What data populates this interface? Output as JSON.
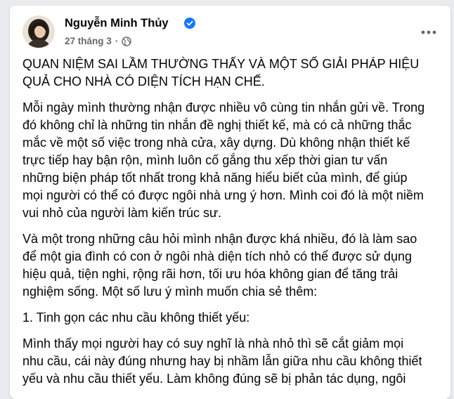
{
  "post": {
    "author": "Nguyễn Minh Thủy",
    "date": "27 tháng 3",
    "separator": "·",
    "verified_icon": "verified-badge-icon",
    "privacy_icon": "globe-icon",
    "more_icon": "more-options-icon",
    "colors": {
      "verified": "#1877f2",
      "meta": "#65676b",
      "text": "#050505"
    },
    "paragraphs": [
      "QUAN NIỆM SAI LẦM THƯỜNG THẤY VÀ MỘT SỐ GIẢI PHÁP HIỆU\nQUẢ CHO NHÀ CÓ DIỆN TÍCH HẠN CHẾ.",
      "Mỗi ngày mình thường nhận được nhiều vô cùng tin nhắn gửi về. Trong\nđó không chỉ là những tin nhắn đề nghị thiết kế, mà có cả những thắc\nmắc về một số việc trong nhà cửa, xây dựng. Dù không nhận thiết kế\ntrực tiếp hay bận rộn, mình luôn cố gắng thu xếp thời gian tư vấn\nnhững biện pháp tốt nhất trong khả năng hiểu biết của mình, để giúp\nmọi người có thể có được ngôi nhà ưng ý hơn. Mình coi đó là một niềm\nvui nhỏ của người làm kiến trúc sư.",
      "Và một trong những câu hỏi mình nhận được khá nhiều, đó là làm sao\nđể một gia đình có con ở ngôi nhà diện tích nhỏ có thể được sử dụng\nhiệu quả, tiện nghi, rộng rãi hơn, tối ưu hóa không gian để tăng trải\nnghiệm sống. Một số lưu ý mình muốn chia sẻ thêm:",
      "1. Tinh gọn các nhu cầu không thiết yếu:",
      "Mình thấy mọi người hay có suy nghĩ là nhà nhỏ thì sẽ cắt giảm mọi\nnhu cầu, cái này đúng nhưng hay bị nhầm lẫn giữa nhu cầu không thiết\nyếu và nhu cầu thiết yếu. Làm không đúng sẽ bị phản tác dụng, ngôi"
    ]
  }
}
